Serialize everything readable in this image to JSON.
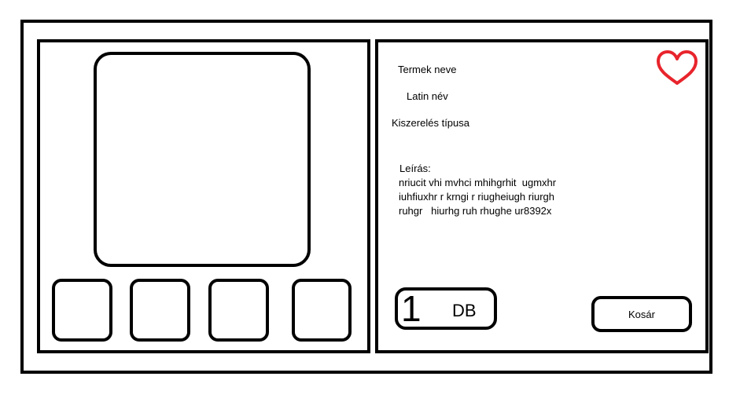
{
  "product": {
    "name": "Termek neve",
    "latin_name": "Latin név",
    "package_type": "Kiszerelés típusa"
  },
  "description": {
    "label": "Leírás:",
    "lines": [
      "nriucit vhi mvhci mhihgrhit  ugmxhr",
      "iuhfiuxhr r krngi r riugheiugh riurgh",
      "ruhgr   hiurhg ruh rhughe ur8392x"
    ]
  },
  "quantity": {
    "value": "1",
    "unit": "DB"
  },
  "cart": {
    "label": "Kosár"
  },
  "favorite": {
    "icon": "heart-icon",
    "color": "#e8242c"
  }
}
